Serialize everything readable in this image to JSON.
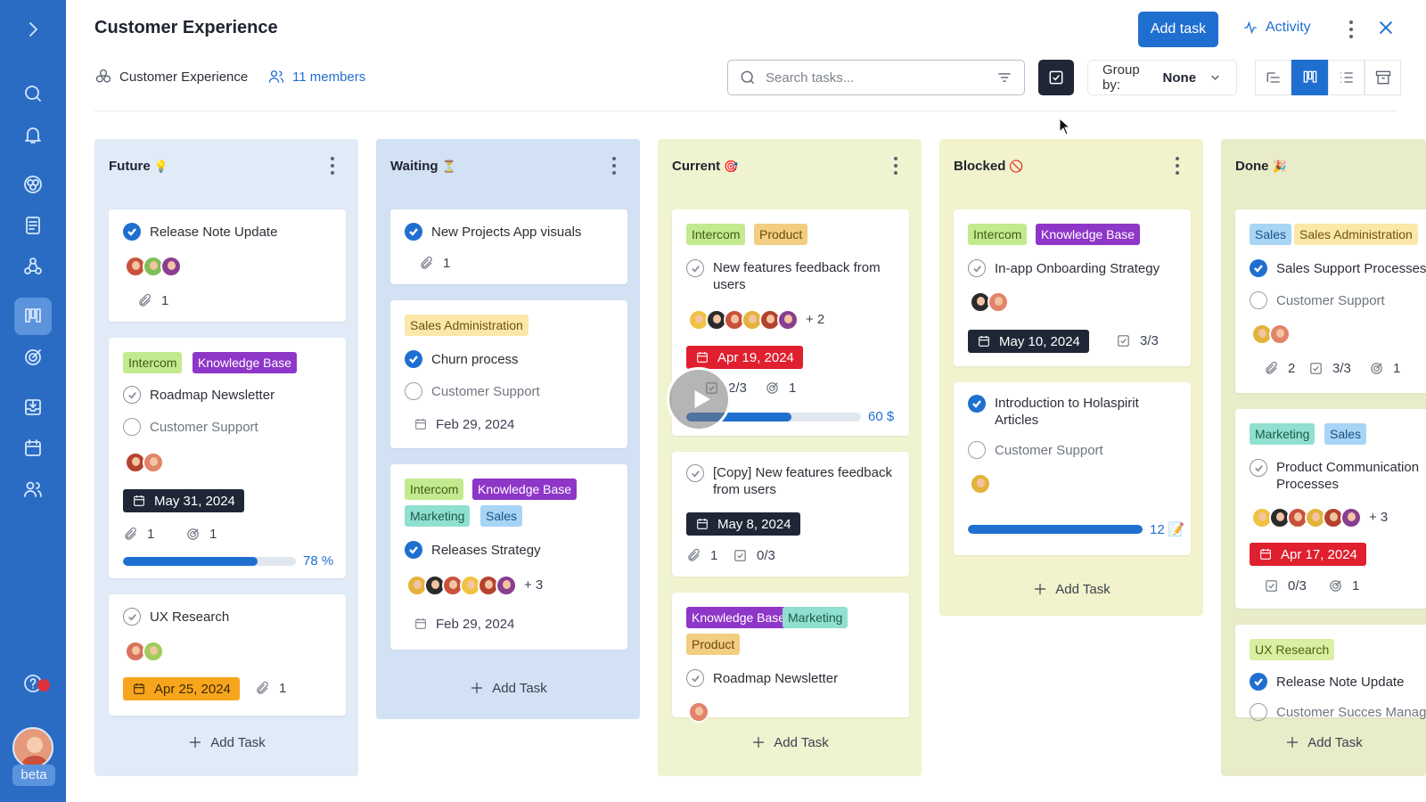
{
  "app": {
    "title": "Customer Experience"
  },
  "header": {
    "workspace": "Customer Experience",
    "members": "11 members",
    "add_task": "Add task",
    "activity": "Activity",
    "search_placeholder": "Search tasks...",
    "group_by_label": "Group by:",
    "group_by_value": "None"
  },
  "rail": {
    "beta": "beta"
  },
  "columns": [
    {
      "title": "Future",
      "emoji": "💡",
      "add": "Add Task",
      "cards": [
        {
          "title": "Release Note Update",
          "attachments": "1"
        },
        {
          "tags": [
            "Intercom",
            "Knowledge Base"
          ],
          "title": "Roadmap Newsletter",
          "subtask": "Customer Support",
          "date": "May 31, 2024",
          "attachments": "1",
          "goals": "1",
          "progress_label": "78 %",
          "progress": 0.78
        },
        {
          "title": "UX Research",
          "date": "Apr 25, 2024",
          "attachments": "1"
        }
      ]
    },
    {
      "title": "Waiting",
      "emoji": "⏳",
      "add": "Add Task",
      "cards": [
        {
          "title": "New Projects App visuals",
          "attachments": "1"
        },
        {
          "tags": [
            "Sales Administration"
          ],
          "title": "Churn process",
          "subtask": "Customer Support",
          "date": "Feb 29, 2024"
        },
        {
          "tags": [
            "Intercom",
            "Knowledge Base",
            "Marketing",
            "Sales"
          ],
          "title": "Releases Strategy",
          "more": "+ 3",
          "date": "Feb 29, 2024"
        }
      ]
    },
    {
      "title": "Current",
      "emoji": "🎯",
      "add": "Add Task",
      "cards": [
        {
          "tags": [
            "Intercom",
            "Product"
          ],
          "title": "New features feedback from users",
          "more": "+ 2",
          "date": "Apr 19, 2024",
          "checklist": "2/3",
          "goals": "1",
          "progress_label": "60 $",
          "progress": 0.6
        },
        {
          "title": "[Copy] New features feedback from users",
          "date": "May 8, 2024",
          "attachments": "1",
          "checklist": "0/3"
        },
        {
          "tags": [
            "Knowledge Base",
            "Marketing",
            "Product"
          ],
          "title": "Roadmap Newsletter"
        }
      ]
    },
    {
      "title": "Blocked",
      "emoji": "🚫",
      "add": "Add Task",
      "cards": [
        {
          "tags": [
            "Intercom",
            "Knowledge Base"
          ],
          "title": "In-app Onboarding Strategy",
          "date": "May 10, 2024",
          "checklist": "3/3"
        },
        {
          "title": "Introduction to Holaspirit Articles",
          "subtask": "Customer Support",
          "progress_label": "12 📝",
          "progress": 1.0
        }
      ]
    },
    {
      "title": "Done",
      "emoji": "🎉",
      "add": "Add Task",
      "cards": [
        {
          "tags": [
            "Sales",
            "Sales Administration"
          ],
          "title": "Sales Support Processes",
          "subtask": "Customer Support",
          "attachments": "2",
          "checklist": "3/3",
          "goals": "1"
        },
        {
          "tags": [
            "Marketing",
            "Sales"
          ],
          "title": "Product Communication Processes",
          "more": "+ 3",
          "date": "Apr 17, 2024",
          "checklist": "0/3",
          "goals": "1"
        },
        {
          "tags": [
            "UX Research"
          ],
          "title": "Release Note Update",
          "subtask": "Customer Succes Manag"
        }
      ]
    }
  ],
  "colors": {
    "accent": "#1f6fd0",
    "rail": "#2a6cc4",
    "future_bg": "#e1eaf7",
    "waiting_bg": "#d3e1f5",
    "current_bg": "#f0f3cf",
    "blocked_bg": "#f2f2cc",
    "done_bg": "#e9ecc8"
  }
}
